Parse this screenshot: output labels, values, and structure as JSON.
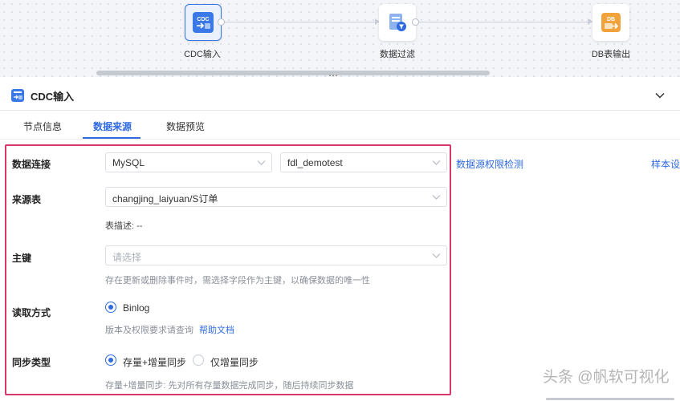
{
  "canvas": {
    "nodes": [
      {
        "label": "CDC输入",
        "badge": "CDC"
      },
      {
        "label": "数据过滤"
      },
      {
        "label": "DB表输出",
        "badge": "DB"
      }
    ],
    "drag_handle": "⋯"
  },
  "panel": {
    "title": "CDC输入",
    "tabs": [
      "节点信息",
      "数据来源",
      "数据预览"
    ],
    "active_tab": "数据来源"
  },
  "form": {
    "connection": {
      "label": "数据连接",
      "type_value": "MySQL",
      "db_value": "fdl_demotest"
    },
    "source_table": {
      "label": "来源表",
      "value": "changjing_laiyuan/S订单",
      "description": "表描述: --"
    },
    "primary_key": {
      "label": "主键",
      "placeholder": "请选择",
      "hint": "存在更新或删除事件时，需选择字段作为主键，以确保数据的唯一性"
    },
    "read_mode": {
      "label": "读取方式",
      "option": "Binlog",
      "hint_prefix": "版本及权限要求请查询",
      "help_link": "帮助文档"
    },
    "sync_type": {
      "label": "同步类型",
      "options": [
        "存量+增量同步",
        "仅增量同步"
      ],
      "selected": "存量+增量同步",
      "hint": "存量+增量同步: 先对所有存量数据完成同步，随后持续同步数据"
    }
  },
  "side_links": {
    "permission_check": "数据源权限检测",
    "sample": "样本设"
  },
  "watermark": "头条 @帆软可视化",
  "colors": {
    "accent": "#2f6ae0",
    "highlight_border": "#d9386b"
  }
}
